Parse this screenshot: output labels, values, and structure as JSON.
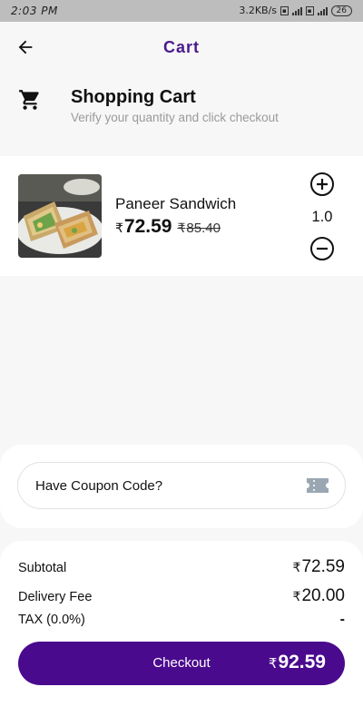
{
  "status_bar": {
    "time": "2:03 PM",
    "network_speed": "3.2KB/s",
    "battery": "26"
  },
  "app_bar": {
    "title": "Cart"
  },
  "cart_header": {
    "title": "Shopping Cart",
    "subtitle": "Verify your quantity and click checkout"
  },
  "cart_items": [
    {
      "name": "Paneer Sandwich",
      "currency": "₹",
      "price": "72.59",
      "original_price": "85.40",
      "quantity": "1.0"
    }
  ],
  "coupon": {
    "label": "Have Coupon Code?"
  },
  "summary": {
    "subtotal_label": "Subtotal",
    "subtotal_value": "72.59",
    "delivery_label": "Delivery Fee",
    "delivery_value": "20.00",
    "tax_label": "TAX (0.0%)",
    "tax_value": "-",
    "currency": "₹"
  },
  "checkout": {
    "label": "Checkout",
    "currency": "₹",
    "total": "92.59"
  },
  "colors": {
    "accent": "#4a0a8e",
    "title": "#4a1a8c",
    "subtitle": "#9a9a9a",
    "background": "#f7f7f7"
  },
  "icons": [
    "back-arrow-icon",
    "cart-icon",
    "plus-circle-icon",
    "minus-circle-icon",
    "ticket-icon"
  ]
}
